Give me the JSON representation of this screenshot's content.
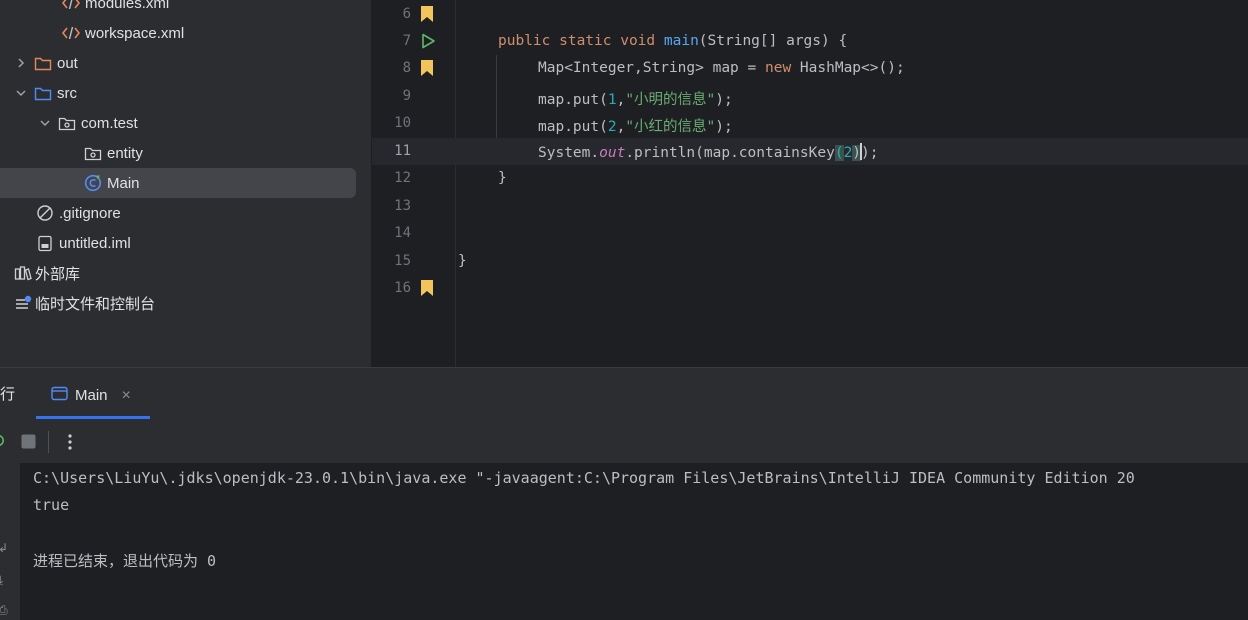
{
  "project_tree": {
    "items": [
      {
        "label": "modules.xml",
        "icon": "xml-file-icon"
      },
      {
        "label": "workspace.xml",
        "icon": "xml-file-icon"
      },
      {
        "label": "out",
        "icon": "folder-icon",
        "expanded": false
      },
      {
        "label": "src",
        "icon": "source-folder-icon",
        "expanded": true
      },
      {
        "label": "com.test",
        "icon": "package-icon",
        "expanded": true
      },
      {
        "label": "entity",
        "icon": "package-icon"
      },
      {
        "label": "Main",
        "icon": "java-class-icon",
        "selected": true
      },
      {
        "label": ".gitignore",
        "icon": "ignore-file-icon"
      },
      {
        "label": "untitled.iml",
        "icon": "module-file-icon"
      },
      {
        "label": "外部库",
        "icon": "external-libraries-icon"
      },
      {
        "label": "临时文件和控制台",
        "icon": "scratches-icon"
      }
    ]
  },
  "editor": {
    "current_line": 11,
    "lines": [
      {
        "n": "6",
        "marker": "bookmark"
      },
      {
        "n": "7",
        "marker": "run",
        "t": {
          "kw1": "public static void ",
          "fn": "main",
          "rest": "(String[] args) {"
        }
      },
      {
        "n": "8",
        "marker": "bookmark",
        "t": {
          "a": "Map<Integer,String> map = ",
          "kw": "new",
          "b": " HashMap<>();"
        }
      },
      {
        "n": "9",
        "t": {
          "a": "map.put(",
          "num": "1",
          "b": ",",
          "str": "\"小明的信息\"",
          "c": ");"
        }
      },
      {
        "n": "10",
        "t": {
          "a": "map.put(",
          "num": "2",
          "b": ",",
          "str": "\"小红的信息\"",
          "c": ");"
        }
      },
      {
        "n": "11",
        "t": {
          "a": "System.",
          "stat": "out",
          "b": ".println(map.containsKey",
          "p1": "(",
          "num": "2",
          "p2": ")",
          "c": ");"
        }
      },
      {
        "n": "12",
        "t": {
          "a": "}"
        }
      },
      {
        "n": "13"
      },
      {
        "n": "14"
      },
      {
        "n": "15",
        "t": {
          "a": "}"
        }
      },
      {
        "n": "16",
        "marker": "bookmark"
      }
    ]
  },
  "run_panel": {
    "title": "行",
    "tab_label": "Main",
    "console": [
      "C:\\Users\\LiuYu\\.jdks\\openjdk-23.0.1\\bin\\java.exe \"-javaagent:C:\\Program Files\\JetBrains\\IntelliJ IDEA Community Edition 20",
      "true",
      "",
      "进程已结束，退出代码为 0"
    ]
  },
  "colors": {
    "keyword": "#cf8e6d",
    "function": "#56a8f5",
    "string": "#6aab73",
    "number": "#2aacb8",
    "static_field": "#c77dbb",
    "accent": "#3574f0",
    "bookmark": "#f2c55c",
    "run": "#5fb865"
  }
}
